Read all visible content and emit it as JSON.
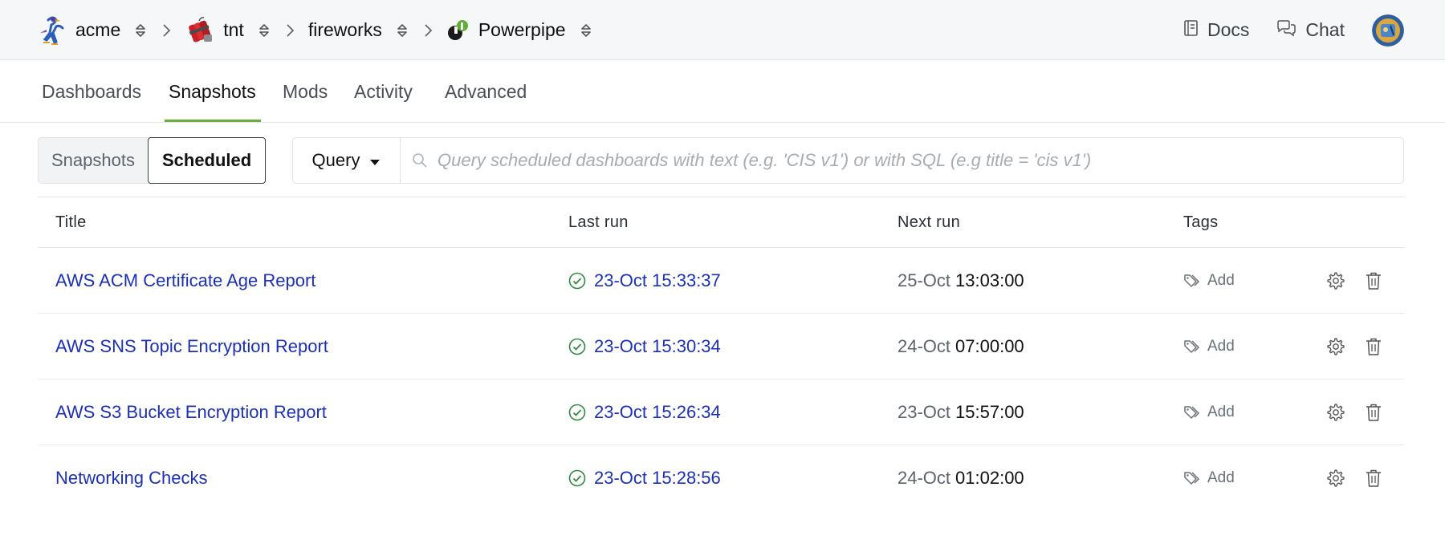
{
  "breadcrumbs": [
    {
      "name": "acme",
      "logo": "roadrunner-logo"
    },
    {
      "name": "tnt",
      "logo": "dynamite-logo"
    },
    {
      "name": "fireworks",
      "logo": ""
    },
    {
      "name": "Powerpipe",
      "logo": "powerpipe-logo"
    }
  ],
  "top_links": {
    "docs": "Docs",
    "chat": "Chat"
  },
  "tabs": [
    "Dashboards",
    "Snapshots",
    "Mods",
    "Activity",
    "Advanced"
  ],
  "active_tab": "Snapshots",
  "segment": {
    "options": [
      "Snapshots",
      "Scheduled"
    ],
    "selected": "Scheduled"
  },
  "search": {
    "mode_label": "Query",
    "placeholder": "Query scheduled dashboards with text (e.g. 'CIS v1') or with SQL (e.g title = 'cis v1')",
    "value": ""
  },
  "table": {
    "headers": {
      "title": "Title",
      "last_run": "Last run",
      "next_run": "Next run",
      "tags": "Tags"
    },
    "rows": [
      {
        "title": "AWS ACM Certificate Age Report",
        "last_run": "23-Oct 15:33:37",
        "next_date": "25-Oct",
        "next_time": "13:03:00",
        "tags": "Add"
      },
      {
        "title": "AWS SNS Topic Encryption Report",
        "last_run": "23-Oct 15:30:34",
        "next_date": "24-Oct",
        "next_time": "07:00:00",
        "tags": "Add"
      },
      {
        "title": "AWS S3 Bucket Encryption Report",
        "last_run": "23-Oct 15:26:34",
        "next_date": "23-Oct",
        "next_time": "15:57:00",
        "tags": "Add"
      },
      {
        "title": "Networking Checks",
        "last_run": "23-Oct 15:28:56",
        "next_date": "24-Oct",
        "next_time": "01:02:00",
        "tags": "Add"
      }
    ]
  },
  "colors": {
    "accent": "#6aae3b",
    "link": "#1b30b8",
    "success": "#2e8b3e"
  }
}
